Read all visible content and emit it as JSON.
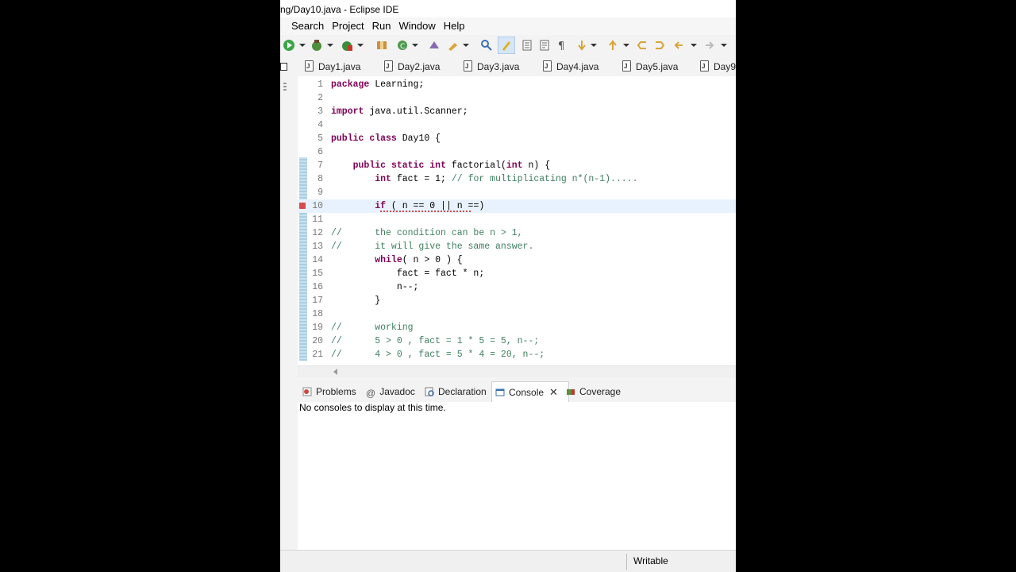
{
  "window": {
    "title": "ng/Day10.java - Eclipse IDE"
  },
  "menu": [
    "Search",
    "Project",
    "Run",
    "Window",
    "Help"
  ],
  "editor_tabs": [
    "Day1.java",
    "Day2.java",
    "Day3.java",
    "Day4.java",
    "Day5.java",
    "Day9"
  ],
  "code_lines": [
    {
      "num": "1",
      "text": "package Learning;"
    },
    {
      "num": "2",
      "text": ""
    },
    {
      "num": "3",
      "text": "import java.util.Scanner;"
    },
    {
      "num": "4",
      "text": ""
    },
    {
      "num": "5",
      "text": "public class Day10 {"
    },
    {
      "num": "6",
      "text": ""
    },
    {
      "num": "7",
      "text": "    public static int factorial(int n) {"
    },
    {
      "num": "8",
      "text": "        int fact = 1; // for multiplicating n*(n-1)....."
    },
    {
      "num": "9",
      "text": ""
    },
    {
      "num": "10",
      "text": "        if ( n == 0 || n ==)"
    },
    {
      "num": "11",
      "text": ""
    },
    {
      "num": "12",
      "text": "//      the condition can be n > 1,"
    },
    {
      "num": "13",
      "text": "//      it will give the same answer."
    },
    {
      "num": "14",
      "text": "        while( n > 0 ) {"
    },
    {
      "num": "15",
      "text": "            fact = fact * n;"
    },
    {
      "num": "16",
      "text": "            n--;"
    },
    {
      "num": "17",
      "text": "        }"
    },
    {
      "num": "18",
      "text": ""
    },
    {
      "num": "19",
      "text": "//      working"
    },
    {
      "num": "20",
      "text": "//      5 > 0 , fact = 1 * 5 = 5, n--;"
    },
    {
      "num": "21",
      "text": "//      4 > 0 , fact = 5 * 4 = 20, n--;"
    }
  ],
  "view_tabs": [
    "Problems",
    "Javadoc",
    "Declaration",
    "Console",
    "Coverage"
  ],
  "console": {
    "message": "No consoles to display at this time."
  },
  "status": {
    "writable": "Writable"
  },
  "colors": {
    "keyword": "#7f0055",
    "comment": "#3f7f5f",
    "current_line": "#e8f2fe",
    "error": "#d64b4b"
  }
}
